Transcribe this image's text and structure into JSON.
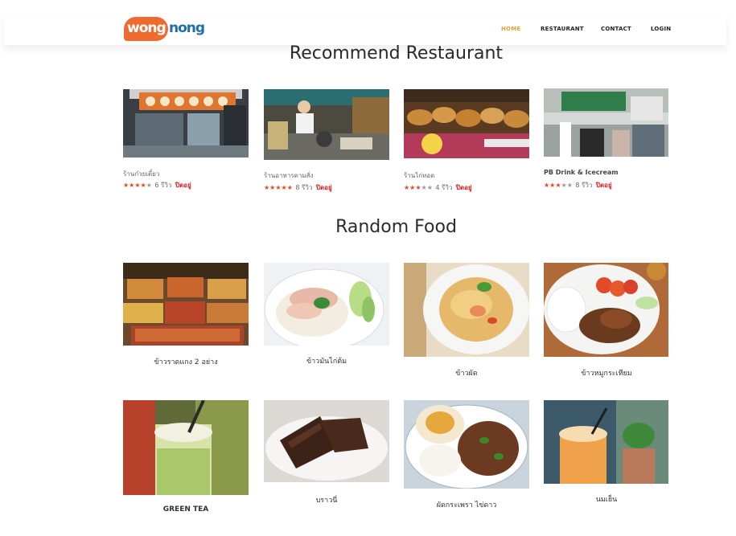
{
  "header": {
    "logo_left": "wong",
    "logo_right": "nong",
    "nav": [
      {
        "label": "HOME",
        "active": true
      },
      {
        "label": "RESTAURANT",
        "active": false
      },
      {
        "label": "CONTACT",
        "active": false
      },
      {
        "label": "LOGIN",
        "active": false
      }
    ]
  },
  "colors": {
    "accent_orange": "#ef6a2f",
    "brand_blue": "#1e6fa8",
    "nav_active": "#f0a030",
    "star": "#e04a25",
    "status_red": "#d62020"
  },
  "recommend": {
    "title": "Recommend Restaurant",
    "restaurants": [
      {
        "name": "ร้านก๋วยเตี๋ยว",
        "stars": 4,
        "reviews": "6 รีวิว",
        "status": "ปิดอยู่"
      },
      {
        "name": "ร้านอาหารตามสั่ง",
        "stars": 5,
        "reviews": "8 รีวิว",
        "status": "ปิดอยู่"
      },
      {
        "name": "ร้านไก่ทอด",
        "stars": 3,
        "reviews": "4 รีวิว",
        "status": "ปิดอยู่"
      },
      {
        "name": "PB Drink & Icecream",
        "stars": 3,
        "reviews": "8 รีวิว",
        "status": "ปิดอยู่"
      }
    ]
  },
  "random": {
    "title": "Random Food",
    "foods": [
      {
        "name": "ข้าวราดแกง 2 อย่าง"
      },
      {
        "name": "ข้าวมันไก่ต้ม"
      },
      {
        "name": "ข้าวผัด"
      },
      {
        "name": "ข้าวหมูกระเทียม"
      },
      {
        "name": "GREEN TEA"
      },
      {
        "name": "บราวนี่"
      },
      {
        "name": "ผัดกระเพรา ไข่ดาว"
      },
      {
        "name": "นมเย็น"
      }
    ]
  }
}
